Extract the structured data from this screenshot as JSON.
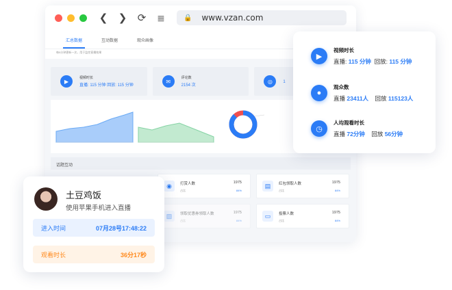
{
  "browser": {
    "url": "www.vzan.com",
    "dot_colors": [
      "#ff5f57",
      "#ffbd2e",
      "#28c840"
    ],
    "back_icon": "back-icon",
    "forward_icon": "forward-icon",
    "reload_icon": "reload-icon",
    "apps_icon": "apps-icon",
    "lock_icon": "lock-icon"
  },
  "dashboard": {
    "tabs": [
      "汇总数据",
      "互动数据",
      "观众画像"
    ],
    "update_note": "每5分钟更新一次，用于监控直播效果",
    "stats": [
      {
        "title": "视频时长",
        "value": "直播: 115 分钟   回放: 115 分钟"
      },
      {
        "title": "评论数",
        "value": "2154 次"
      },
      {
        "title": "",
        "value": "1"
      }
    ],
    "donut_values": [
      88,
      12
    ],
    "section_title": "话题互动",
    "interactions": [
      {
        "label": "打赏人数",
        "sub": "占比",
        "value": "1975",
        "pct": "84%"
      },
      {
        "label": "红包领取人数",
        "sub": "占比",
        "value": "1975",
        "pct": "84%"
      },
      {
        "label": "领取优惠券领取人数",
        "sub": "占比",
        "value": "1975",
        "pct": "84%"
      },
      {
        "label": "投票人数",
        "sub": "占比",
        "value": "1975",
        "pct": "84%"
      }
    ]
  },
  "summary_card": {
    "video_duration": {
      "title": "视频时长",
      "live_label": "直播:",
      "live_value": "115 分钟",
      "replay_label": "回放:",
      "replay_value": "115 分钟"
    },
    "viewers": {
      "title": "观众数",
      "live_label": "直播",
      "live_value": "23411人",
      "replay_label": "回放",
      "replay_value": "115123人"
    },
    "avg_watch": {
      "title": "人均观看时长",
      "live_label": "直播",
      "live_value": "72分钟",
      "replay_label": "回放",
      "replay_value": "56分钟"
    }
  },
  "user_card": {
    "name": "土豆鸡饭",
    "device": "使用苹果手机进入直播",
    "enter_label": "进入时间",
    "enter_value": "07月28号17:48:22",
    "watch_label": "观看时长",
    "watch_value": "36分17秒"
  },
  "colors": {
    "accent": "#2b7cf6",
    "orange": "#ff8a1e",
    "red": "#f0504f"
  }
}
